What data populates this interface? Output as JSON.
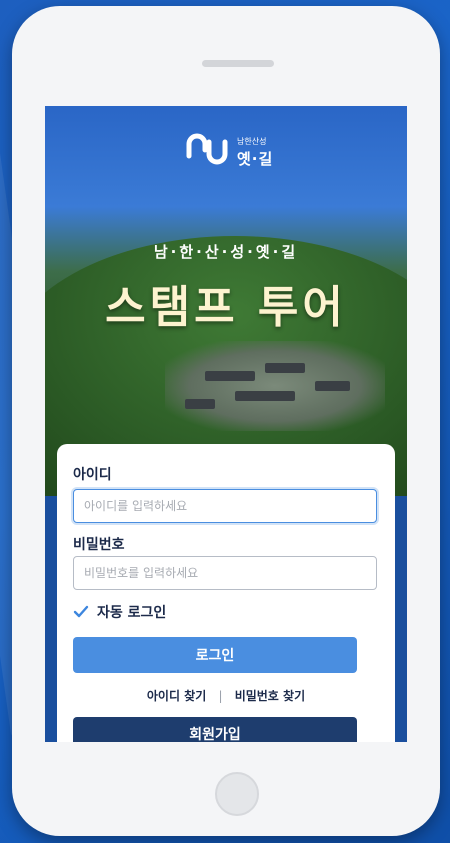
{
  "brand": {
    "logo_small": "남한산성",
    "logo_big": "옛·길"
  },
  "hero": {
    "subtitle": "남·한·산·성·옛·길",
    "title": "스탬프 투어"
  },
  "login_form": {
    "id_label": "아이디",
    "id_placeholder": "아이디를 입력하세요",
    "id_value": "",
    "password_label": "비밀번호",
    "password_placeholder": "비밀번호를 입력하세요",
    "password_value": "",
    "auto_login_label": "자동 로그인",
    "auto_login_checked": true,
    "login_button": "로그인",
    "find_id_link": "아이디 찾기",
    "link_separator": "|",
    "find_password_link": "비밀번호 찾기",
    "signup_button": "회원가입"
  },
  "colors": {
    "accent": "#4a8ee0",
    "primary_dark": "#1e3d6e",
    "background": "#1a64c8",
    "title_color": "#fdf3cf"
  }
}
